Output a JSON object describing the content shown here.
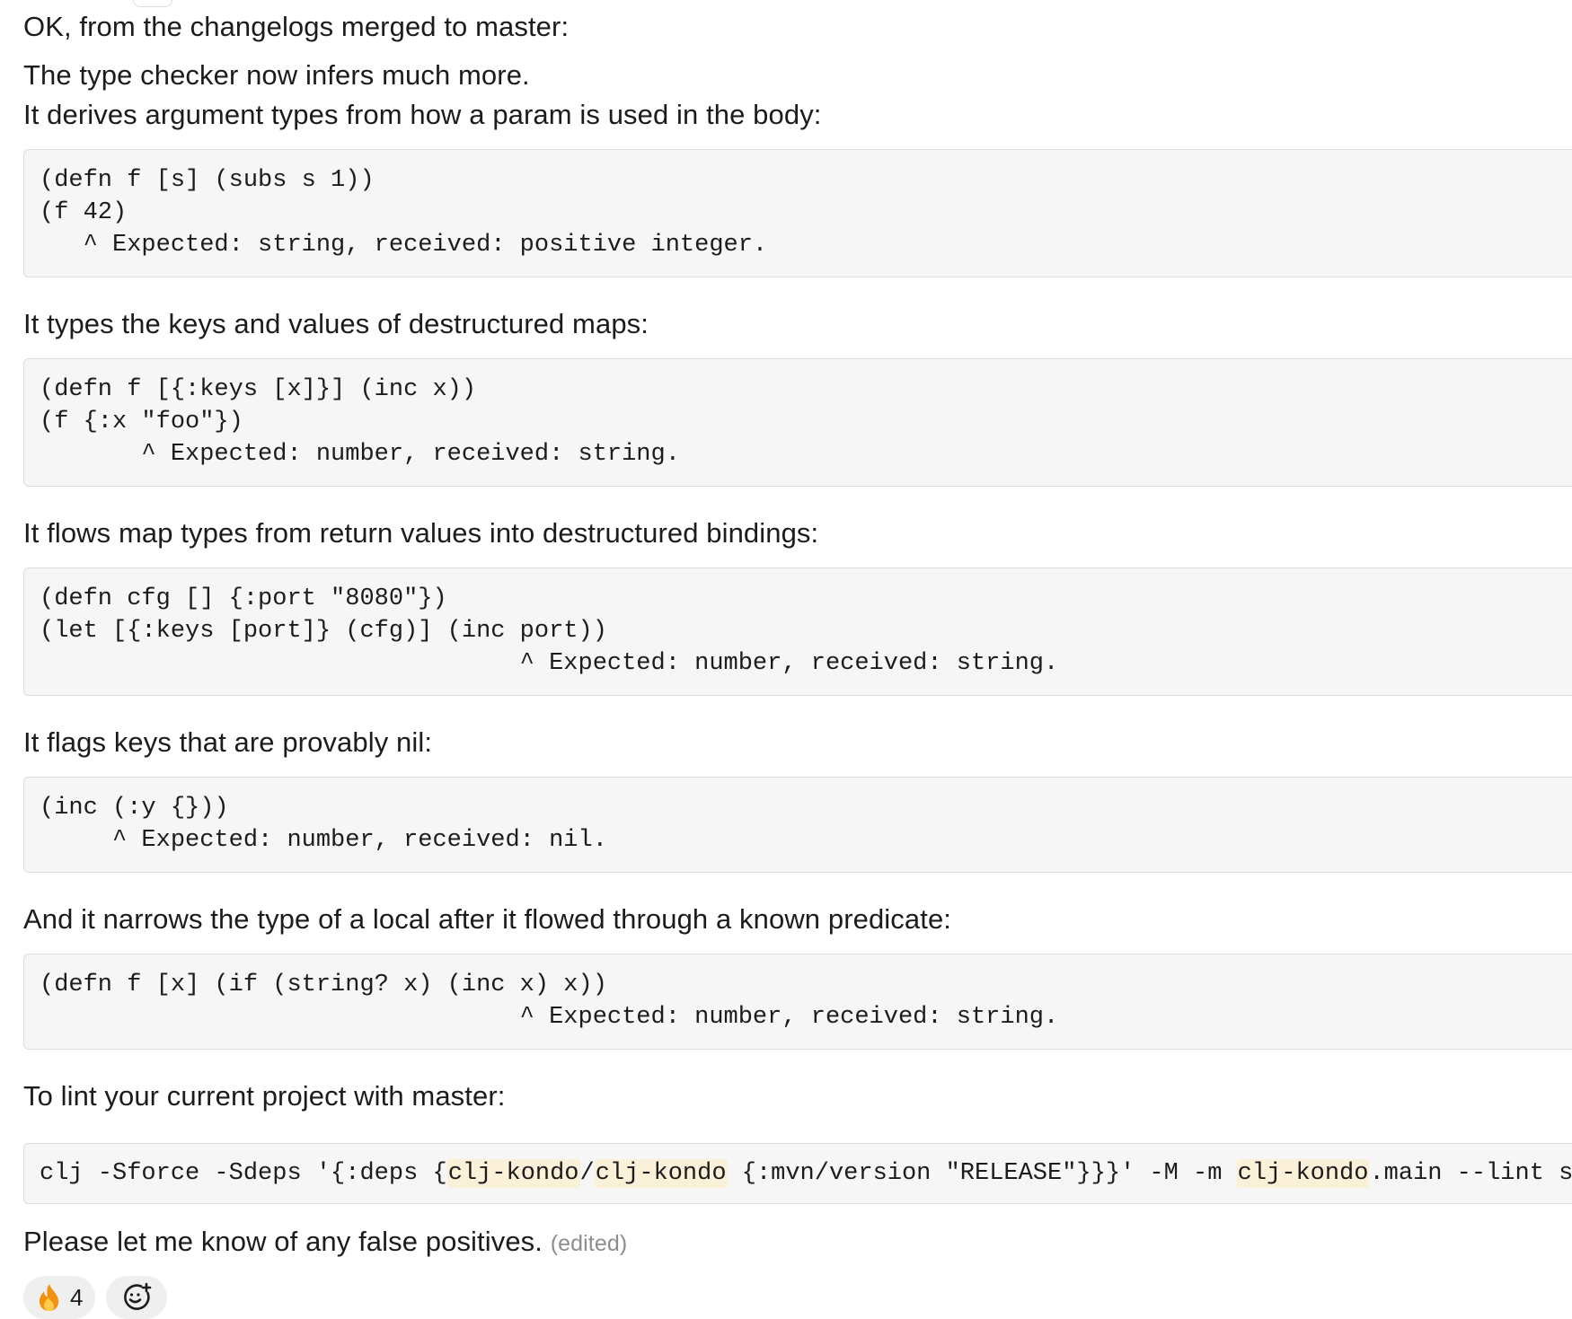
{
  "intro": "OK, from the changelogs merged to master:",
  "lead_1": "The type checker now infers much more.",
  "lead_2": "It derives argument types from how a param is used in the body:",
  "code_1": "(defn f [s] (subs s 1))\n(f 42)\n   ^ Expected: string, received: positive integer.",
  "text_2": "It types the keys and values of destructured maps:",
  "code_2": "(defn f [{:keys [x]}] (inc x))\n(f {:x \"foo\"})\n       ^ Expected: number, received: string.",
  "text_3": "It flows map types from return values into destructured bindings:",
  "code_3": "(defn cfg [] {:port \"8080\"})\n(let [{:keys [port]} (cfg)] (inc port))\n                                 ^ Expected: number, received: string.",
  "text_4": "It flags keys that are provably nil:",
  "code_4": "(inc (:y {}))\n     ^ Expected: number, received: nil.",
  "text_5": "And it narrows the type of a local after it flowed through a known predicate:",
  "code_5": "(defn f [x] (if (string? x) (inc x) x))\n                                 ^ Expected: number, received: string.",
  "text_6": "To lint your current project with master:",
  "command": {
    "part_1": "clj -Sforce -Sdeps '{:deps {",
    "lib_org": "clj-kondo",
    "slash": "/",
    "lib_name": "clj-kondo",
    "part_2": " {:mvn/version \"RELEASE\"}}}' -M -m ",
    "ns": "clj-kondo",
    "part_3": ".main --lint src:test"
  },
  "closing": "Please let me know of any false positives.",
  "edited_label": "(edited)",
  "reactions": {
    "fire": {
      "icon": "fire-emoji",
      "count": "4"
    },
    "add": {
      "icon": "add-reaction-icon"
    }
  },
  "colors": {
    "text": "#1d1c1d",
    "code_bg": "#f6f6f6",
    "code_border": "#dddddd",
    "highlight": "#fbf0d8",
    "muted": "#8d8d8d",
    "reaction_bg": "#efefef",
    "fire_orange": "#f4900c"
  }
}
